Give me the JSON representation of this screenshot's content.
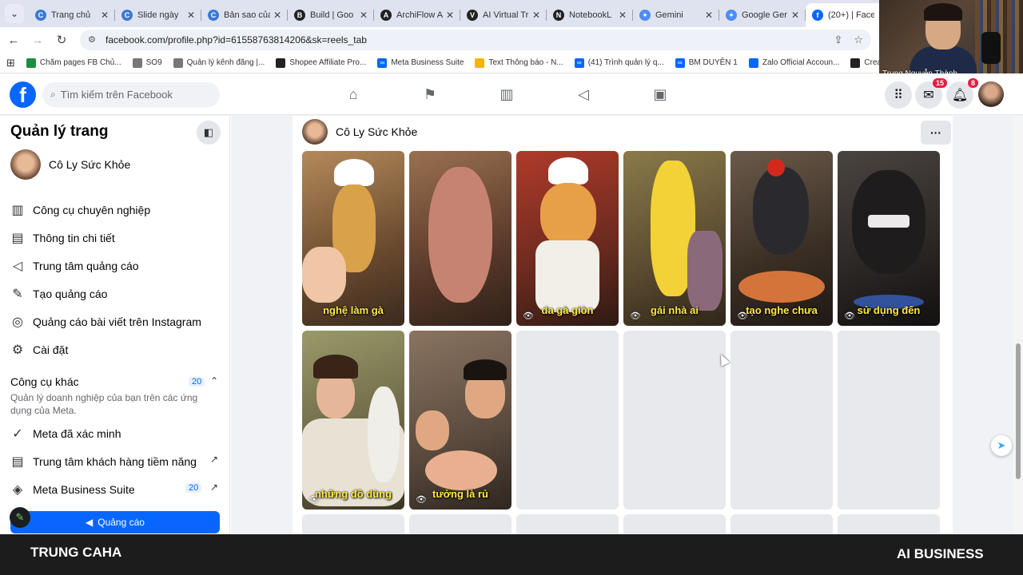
{
  "tabs": [
    {
      "label": "Trang chủ",
      "color": "#3a7bd5",
      "glyph": "C"
    },
    {
      "label": "Slide ngày",
      "color": "#3a7bd5",
      "glyph": "C"
    },
    {
      "label": "Bản sao của",
      "color": "#3a7bd5",
      "glyph": "C"
    },
    {
      "label": "Build | Goo",
      "color": "#222222",
      "glyph": "B"
    },
    {
      "label": "ArchiFlow A",
      "color": "#222222",
      "glyph": "A"
    },
    {
      "label": "AI Virtual Tr",
      "color": "#222222",
      "glyph": "V"
    },
    {
      "label": "NotebookL",
      "color": "#222222",
      "glyph": "N"
    },
    {
      "label": "Gemini",
      "color": "#4e8cf5",
      "glyph": "✦"
    },
    {
      "label": "Google Ger",
      "color": "#4e8cf5",
      "glyph": "✦"
    },
    {
      "label": "(20+) | Face",
      "color": "#0866ff",
      "glyph": "f"
    }
  ],
  "url": "facebook.com/profile.php?id=61558763814206&sk=reels_tab",
  "bookmarks": [
    {
      "label": "Chăm pages FB Chủ...",
      "color": "#1e8e3e"
    },
    {
      "label": "SO9",
      "color": "#777777"
    },
    {
      "label": "Quản lý kênh đăng |...",
      "color": "#777777"
    },
    {
      "label": "Shopee Affiliate Pro...",
      "color": "#222222"
    },
    {
      "label": "Meta Business Suite",
      "color": "#0866ff"
    },
    {
      "label": "Text Thông báo - N...",
      "color": "#f4b400"
    },
    {
      "label": "(41) Trình quản lý q...",
      "color": "#0866ff"
    },
    {
      "label": "BM DUYÊN 1",
      "color": "#0866ff"
    },
    {
      "label": "Zalo Official Accoun...",
      "color": "#0068ff"
    },
    {
      "label": "Create Vide",
      "color": "#222222"
    }
  ],
  "webcam": {
    "name": "Trung Nguyễn Thành"
  },
  "fbnav": {
    "search_placeholder": "Tìm kiếm trên Facebook",
    "messenger_badge": "15",
    "notifications_badge": "8"
  },
  "sidebar": {
    "title": "Quản lý trang",
    "page_name": "Cô Ly Sức Khỏe",
    "items": [
      {
        "label": "Công cụ chuyên nghiệp",
        "icon": "chart-icon",
        "glyph": "▥"
      },
      {
        "label": "Thông tin chi tiết",
        "icon": "insights-icon",
        "glyph": "▤"
      },
      {
        "label": "Trung tâm quảng cáo",
        "icon": "megaphone-icon",
        "glyph": "📢"
      },
      {
        "label": "Tạo quảng cáo",
        "icon": "edit-icon",
        "glyph": "✎"
      },
      {
        "label": "Quảng cáo bài viết trên Instagram",
        "icon": "instagram-icon",
        "glyph": "◎"
      },
      {
        "label": "Cài đặt",
        "icon": "gear-icon",
        "glyph": "⚙"
      }
    ],
    "other_tools": {
      "title": "Công cụ khác",
      "count": "20",
      "description": "Quản lý doanh nghiệp của bạn trên các ứng dụng của Meta."
    },
    "meta_verified": "Meta đã xác minh",
    "leads_center": "Trung tâm khách hàng tiềm năng",
    "business_suite": "Meta Business Suite",
    "business_suite_count": "20",
    "ads_button": "Quảng cáo"
  },
  "main": {
    "page_name": "Cô Ly Sức Khỏe",
    "reels": [
      {
        "caption": "nghệ làm gà",
        "bg": "#8a6a4a"
      },
      {
        "caption": "",
        "bg": "#6e4a3a"
      },
      {
        "caption": "da gà giòn",
        "bg": "#7a3a2a"
      },
      {
        "caption": "gái nhà ai",
        "bg": "#6a5a3a"
      },
      {
        "caption": "tạo nghe chưa",
        "bg": "#4a3a2e"
      },
      {
        "caption": "sử dụng đến",
        "bg": "#2e2a28"
      },
      {
        "caption": "những đồ dùng",
        "bg": "#6a6a4a"
      },
      {
        "caption": "tưởng là rủ",
        "bg": "#5a4a3e"
      }
    ]
  },
  "banner": {
    "left": "TRUNG CAHA",
    "right": "AI BUSINESS"
  }
}
